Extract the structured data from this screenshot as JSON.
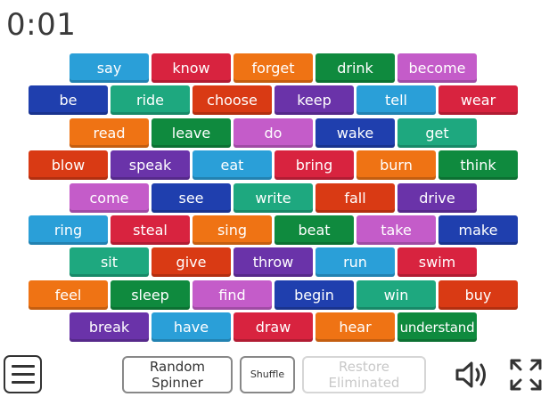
{
  "timer": "0:01",
  "colors": {
    "blue": "#2a9fd8",
    "red": "#d8233f",
    "orange": "#ef7314",
    "green": "#0f8a3e",
    "magenta": "#c45cc9",
    "navy": "#1f3fae",
    "teal": "#1ea87f",
    "purple": "#6a33a9",
    "darkred": "#d93a14"
  },
  "rows": [
    [
      {
        "word": "say",
        "color": "blue"
      },
      {
        "word": "know",
        "color": "red"
      },
      {
        "word": "forget",
        "color": "orange"
      },
      {
        "word": "drink",
        "color": "green"
      },
      {
        "word": "become",
        "color": "magenta"
      }
    ],
    [
      {
        "word": "be",
        "color": "navy"
      },
      {
        "word": "ride",
        "color": "teal"
      },
      {
        "word": "choose",
        "color": "darkred"
      },
      {
        "word": "keep",
        "color": "purple"
      },
      {
        "word": "tell",
        "color": "blue"
      },
      {
        "word": "wear",
        "color": "red"
      }
    ],
    [
      {
        "word": "read",
        "color": "orange"
      },
      {
        "word": "leave",
        "color": "green"
      },
      {
        "word": "do",
        "color": "magenta"
      },
      {
        "word": "wake",
        "color": "navy"
      },
      {
        "word": "get",
        "color": "teal"
      }
    ],
    [
      {
        "word": "blow",
        "color": "darkred"
      },
      {
        "word": "speak",
        "color": "purple"
      },
      {
        "word": "eat",
        "color": "blue"
      },
      {
        "word": "bring",
        "color": "red"
      },
      {
        "word": "burn",
        "color": "orange"
      },
      {
        "word": "think",
        "color": "green"
      }
    ],
    [
      {
        "word": "come",
        "color": "magenta"
      },
      {
        "word": "see",
        "color": "navy"
      },
      {
        "word": "write",
        "color": "teal"
      },
      {
        "word": "fall",
        "color": "darkred"
      },
      {
        "word": "drive",
        "color": "purple"
      }
    ],
    [
      {
        "word": "ring",
        "color": "blue"
      },
      {
        "word": "steal",
        "color": "red"
      },
      {
        "word": "sing",
        "color": "orange"
      },
      {
        "word": "beat",
        "color": "green"
      },
      {
        "word": "take",
        "color": "magenta"
      },
      {
        "word": "make",
        "color": "navy"
      }
    ],
    [
      {
        "word": "sit",
        "color": "teal"
      },
      {
        "word": "give",
        "color": "darkred"
      },
      {
        "word": "throw",
        "color": "purple"
      },
      {
        "word": "run",
        "color": "blue"
      },
      {
        "word": "swim",
        "color": "red"
      }
    ],
    [
      {
        "word": "feel",
        "color": "orange"
      },
      {
        "word": "sleep",
        "color": "green"
      },
      {
        "word": "find",
        "color": "magenta"
      },
      {
        "word": "begin",
        "color": "navy"
      },
      {
        "word": "win",
        "color": "teal"
      },
      {
        "word": "buy",
        "color": "darkred"
      }
    ],
    [
      {
        "word": "break",
        "color": "purple"
      },
      {
        "word": "have",
        "color": "blue"
      },
      {
        "word": "draw",
        "color": "red"
      },
      {
        "word": "hear",
        "color": "orange"
      },
      {
        "word": "understand",
        "color": "green"
      }
    ]
  ],
  "controls": {
    "random_spinner_line1": "Random",
    "random_spinner_line2": "Spinner",
    "shuffle": "Shuffle",
    "restore_line1": "Restore",
    "restore_line2": "Eliminated"
  },
  "icons": {
    "menu": "hamburger-menu-icon",
    "sound": "speaker-icon",
    "fullscreen": "fullscreen-icon"
  }
}
